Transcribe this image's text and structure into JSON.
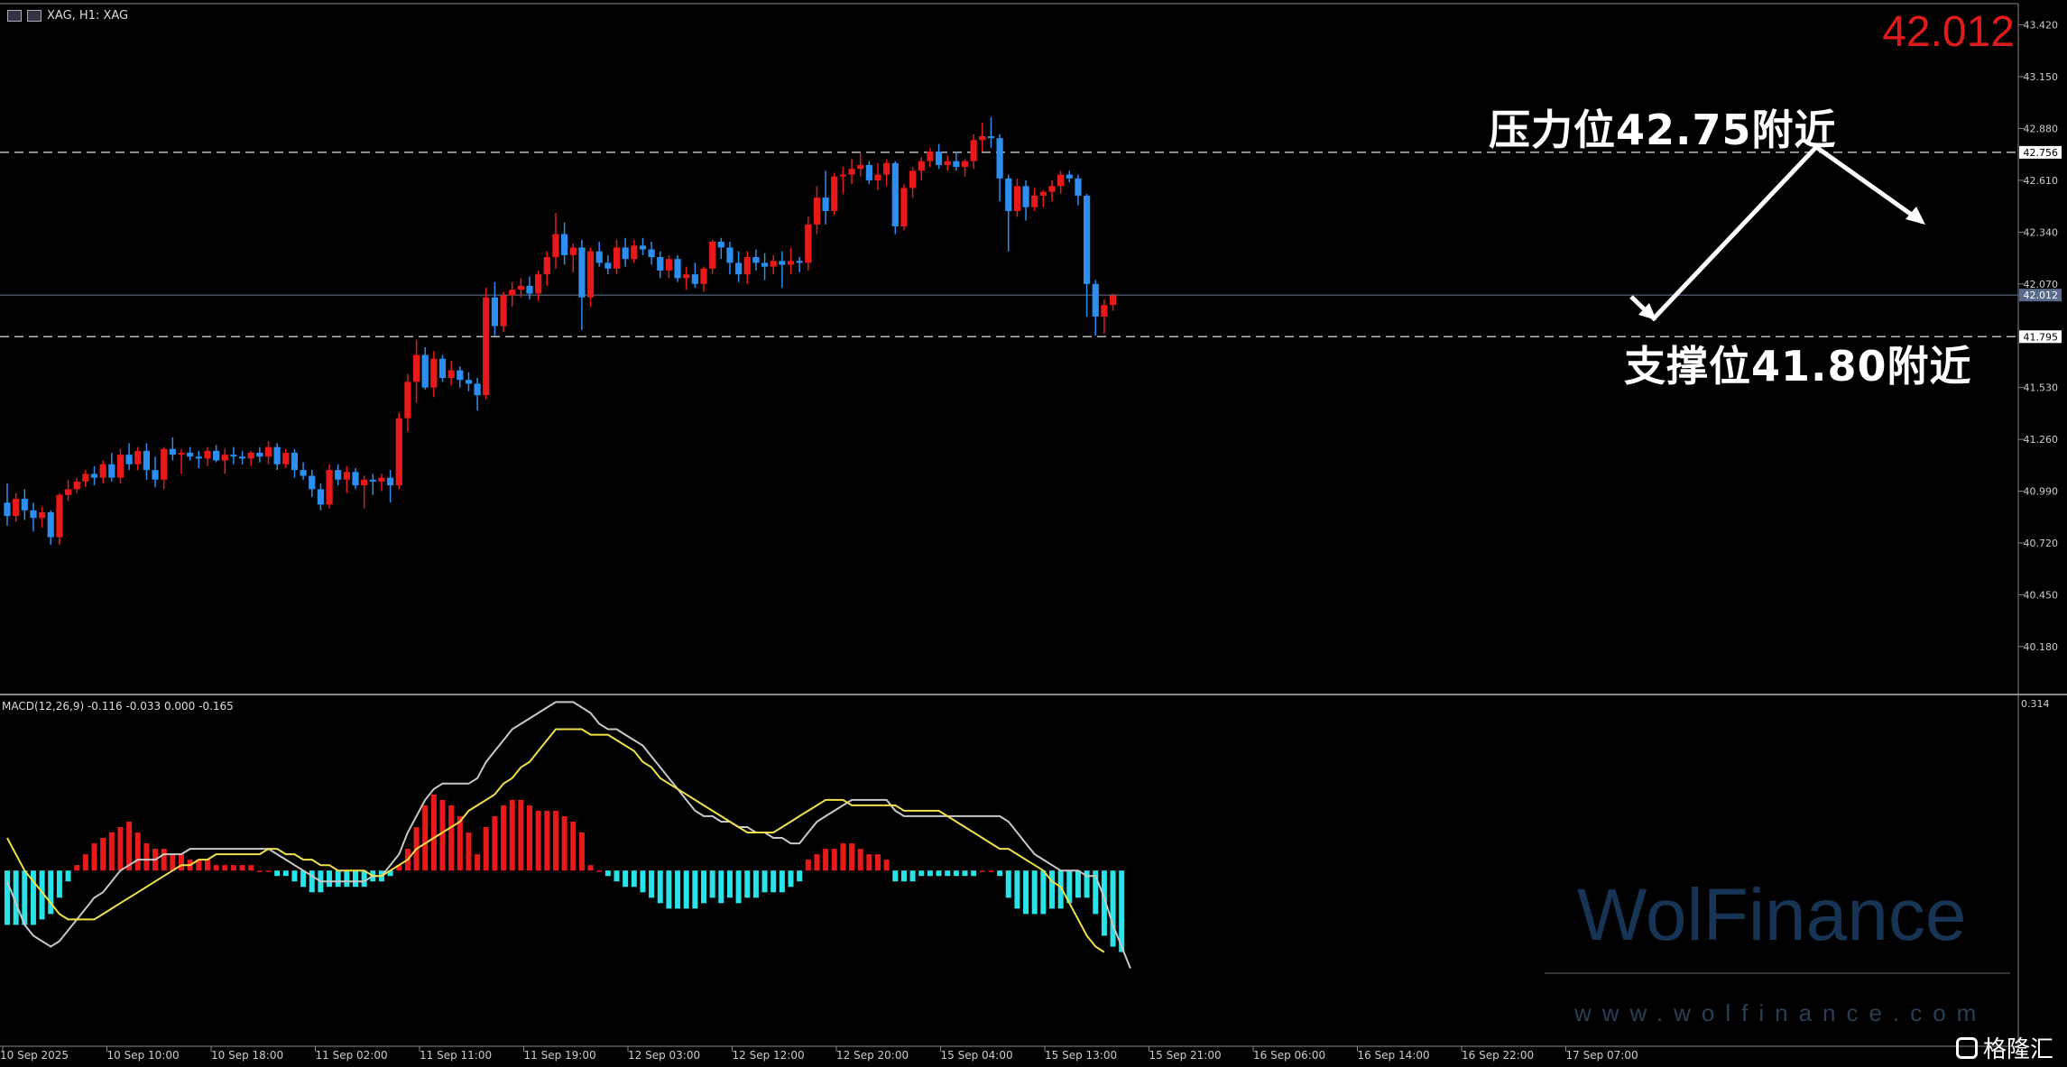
{
  "header": {
    "symbol_label": "XAG, H1:  XAG",
    "current_price": "42.012"
  },
  "annotations": {
    "resistance": "压力位42.75附近",
    "support": "支撑位41.80附近"
  },
  "macd_panel": {
    "label": "MACD(12,26,9) -0.116 -0.033 0.000 -0.165",
    "top_value": "0.314"
  },
  "watermark": {
    "brand": "WolFinance",
    "site": "www.wolfinance.com"
  },
  "logo": {
    "text": "格隆汇"
  },
  "colors": {
    "bull": "#e8191b",
    "bear": "#2b8ef0",
    "hist_pos": "#e8191b",
    "hist_neg": "#29e3e8",
    "macd_line": "#c8c8c8",
    "signal_line": "#f0e04a",
    "current_price_label": "#e01b1b"
  },
  "chart_data": {
    "type": "candlestick",
    "timeframe": "H1",
    "price_ylim": [
      39.93,
      43.55
    ],
    "price_ticks": [
      "43.420",
      "43.150",
      "42.880",
      "42.610",
      "42.340",
      "42.070",
      "41.530",
      "41.260",
      "40.990",
      "40.720",
      "40.450",
      "40.180"
    ],
    "price_levels": {
      "resistance": "42.756",
      "current": "42.012",
      "support": "41.795"
    },
    "x_tick_labels": [
      "10 Sep 2025",
      "10 Sep 10:00",
      "10 Sep 18:00",
      "11 Sep 02:00",
      "11 Sep 11:00",
      "11 Sep 19:00",
      "12 Sep 03:00",
      "12 Sep 12:00",
      "12 Sep 20:00",
      "15 Sep 04:00",
      "15 Sep 13:00",
      "15 Sep 21:00",
      "16 Sep 06:00",
      "16 Sep 14:00",
      "16 Sep 22:00",
      "17 Sep 07:00"
    ],
    "candles": [
      [
        40.93,
        41.03,
        40.81,
        40.86
      ],
      [
        40.86,
        40.98,
        40.83,
        40.95
      ],
      [
        40.95,
        41.0,
        40.84,
        40.89
      ],
      [
        40.89,
        40.93,
        40.78,
        40.85
      ],
      [
        40.85,
        40.91,
        40.8,
        40.88
      ],
      [
        40.88,
        40.89,
        40.71,
        40.75
      ],
      [
        40.75,
        40.98,
        40.71,
        40.97
      ],
      [
        40.97,
        41.05,
        40.94,
        41.0
      ],
      [
        41.0,
        41.06,
        40.98,
        41.04
      ],
      [
        41.04,
        41.1,
        41.01,
        41.08
      ],
      [
        41.08,
        41.12,
        41.02,
        41.06
      ],
      [
        41.06,
        41.15,
        41.03,
        41.13
      ],
      [
        41.13,
        41.19,
        41.04,
        41.06
      ],
      [
        41.06,
        41.21,
        41.03,
        41.18
      ],
      [
        41.18,
        41.24,
        41.1,
        41.13
      ],
      [
        41.13,
        41.22,
        41.1,
        41.2
      ],
      [
        41.2,
        41.24,
        41.05,
        41.1
      ],
      [
        41.1,
        41.17,
        41.01,
        41.05
      ],
      [
        41.05,
        41.22,
        41.0,
        41.21
      ],
      [
        41.21,
        41.27,
        41.15,
        41.18
      ],
      [
        41.18,
        41.21,
        41.08,
        41.19
      ],
      [
        41.19,
        41.22,
        41.15,
        41.17
      ],
      [
        41.17,
        41.2,
        41.11,
        41.16
      ],
      [
        41.16,
        41.22,
        41.12,
        41.2
      ],
      [
        41.2,
        41.23,
        41.14,
        41.15
      ],
      [
        41.15,
        41.21,
        41.08,
        41.18
      ],
      [
        41.18,
        41.22,
        41.13,
        41.17
      ],
      [
        41.17,
        41.2,
        41.13,
        41.16
      ],
      [
        41.16,
        41.2,
        41.12,
        41.19
      ],
      [
        41.19,
        41.22,
        41.14,
        41.17
      ],
      [
        41.17,
        41.25,
        41.13,
        41.22
      ],
      [
        41.22,
        41.24,
        41.1,
        41.13
      ],
      [
        41.13,
        41.21,
        41.11,
        41.19
      ],
      [
        41.19,
        41.21,
        41.06,
        41.1
      ],
      [
        41.1,
        41.14,
        41.05,
        41.07
      ],
      [
        41.07,
        41.1,
        40.96,
        41.0
      ],
      [
        41.0,
        41.03,
        40.89,
        40.92
      ],
      [
        40.92,
        41.13,
        40.9,
        41.1
      ],
      [
        41.1,
        41.13,
        41.02,
        41.05
      ],
      [
        41.05,
        41.12,
        40.98,
        41.09
      ],
      [
        41.09,
        41.11,
        41.0,
        41.02
      ],
      [
        41.02,
        41.07,
        40.9,
        41.05
      ],
      [
        41.05,
        41.08,
        40.97,
        41.04
      ],
      [
        41.04,
        41.08,
        40.99,
        41.06
      ],
      [
        41.06,
        41.1,
        40.93,
        41.02
      ],
      [
        41.02,
        41.4,
        41.0,
        41.37
      ],
      [
        41.37,
        41.6,
        41.3,
        41.56
      ],
      [
        41.56,
        41.78,
        41.45,
        41.7
      ],
      [
        41.7,
        41.74,
        41.52,
        41.53
      ],
      [
        41.53,
        41.72,
        41.48,
        41.68
      ],
      [
        41.68,
        41.7,
        41.56,
        41.58
      ],
      [
        41.58,
        41.67,
        41.54,
        41.62
      ],
      [
        41.62,
        41.64,
        41.53,
        41.57
      ],
      [
        41.57,
        41.61,
        41.51,
        41.55
      ],
      [
        41.55,
        41.58,
        41.41,
        41.49
      ],
      [
        41.49,
        42.05,
        41.47,
        42.0
      ],
      [
        42.0,
        42.08,
        41.8,
        41.85
      ],
      [
        41.85,
        42.03,
        41.82,
        42.01
      ],
      [
        42.01,
        42.08,
        41.95,
        42.04
      ],
      [
        42.04,
        42.1,
        42.0,
        42.06
      ],
      [
        42.06,
        42.11,
        41.99,
        42.02
      ],
      [
        42.02,
        42.14,
        41.98,
        42.12
      ],
      [
        42.12,
        42.24,
        42.06,
        42.21
      ],
      [
        42.21,
        42.44,
        42.15,
        42.33
      ],
      [
        42.33,
        42.39,
        42.17,
        42.22
      ],
      [
        42.22,
        42.28,
        42.13,
        42.26
      ],
      [
        42.26,
        42.3,
        41.83,
        42.0
      ],
      [
        42.0,
        42.26,
        41.95,
        42.24
      ],
      [
        42.24,
        42.29,
        42.16,
        42.18
      ],
      [
        42.18,
        42.22,
        42.12,
        42.15
      ],
      [
        42.15,
        42.3,
        42.12,
        42.26
      ],
      [
        42.26,
        42.31,
        42.16,
        42.2
      ],
      [
        42.2,
        42.3,
        42.18,
        42.27
      ],
      [
        42.27,
        42.31,
        42.22,
        42.25
      ],
      [
        42.25,
        42.29,
        42.17,
        42.21
      ],
      [
        42.21,
        42.24,
        42.1,
        42.14
      ],
      [
        42.14,
        42.22,
        42.1,
        42.2
      ],
      [
        42.2,
        42.22,
        42.08,
        42.1
      ],
      [
        42.1,
        42.16,
        42.04,
        42.12
      ],
      [
        42.12,
        42.18,
        42.05,
        42.07
      ],
      [
        42.07,
        42.16,
        42.03,
        42.15
      ],
      [
        42.15,
        42.3,
        42.12,
        42.29
      ],
      [
        42.29,
        42.31,
        42.2,
        42.26
      ],
      [
        42.26,
        42.29,
        42.12,
        42.18
      ],
      [
        42.18,
        42.24,
        42.08,
        42.12
      ],
      [
        42.12,
        42.24,
        42.07,
        42.21
      ],
      [
        42.21,
        42.25,
        42.14,
        42.18
      ],
      [
        42.18,
        42.23,
        42.09,
        42.16
      ],
      [
        42.16,
        42.22,
        42.12,
        42.19
      ],
      [
        42.19,
        42.24,
        42.05,
        42.17
      ],
      [
        42.17,
        42.26,
        42.12,
        42.19
      ],
      [
        42.19,
        42.21,
        42.13,
        42.18
      ],
      [
        42.18,
        42.42,
        42.14,
        42.38
      ],
      [
        42.38,
        42.58,
        42.33,
        42.52
      ],
      [
        42.52,
        42.66,
        42.38,
        42.45
      ],
      [
        42.45,
        42.65,
        42.43,
        42.63
      ],
      [
        42.63,
        42.68,
        42.54,
        42.64
      ],
      [
        42.64,
        42.72,
        42.59,
        42.67
      ],
      [
        42.67,
        42.75,
        42.63,
        42.69
      ],
      [
        42.69,
        42.71,
        42.59,
        42.61
      ],
      [
        42.61,
        42.7,
        42.56,
        42.64
      ],
      [
        42.64,
        42.72,
        42.58,
        42.7
      ],
      [
        42.7,
        42.71,
        42.33,
        42.37
      ],
      [
        42.37,
        42.59,
        42.35,
        42.57
      ],
      [
        42.57,
        42.68,
        42.52,
        42.66
      ],
      [
        42.66,
        42.73,
        42.61,
        42.71
      ],
      [
        42.71,
        42.78,
        42.68,
        42.76
      ],
      [
        42.76,
        42.8,
        42.67,
        42.69
      ],
      [
        42.69,
        42.74,
        42.66,
        42.71
      ],
      [
        42.71,
        42.76,
        42.66,
        42.68
      ],
      [
        42.68,
        42.72,
        42.63,
        42.71
      ],
      [
        42.71,
        42.85,
        42.67,
        42.82
      ],
      [
        42.82,
        42.91,
        42.76,
        42.84
      ],
      [
        42.84,
        42.94,
        42.78,
        42.83
      ],
      [
        42.83,
        42.85,
        42.5,
        42.62
      ],
      [
        42.62,
        42.64,
        42.24,
        42.45
      ],
      [
        42.45,
        42.62,
        42.42,
        42.58
      ],
      [
        42.58,
        42.61,
        42.4,
        42.47
      ],
      [
        42.47,
        42.57,
        42.45,
        42.53
      ],
      [
        42.53,
        42.56,
        42.47,
        42.55
      ],
      [
        42.55,
        42.61,
        42.5,
        42.58
      ],
      [
        42.58,
        42.66,
        42.54,
        42.64
      ],
      [
        42.64,
        42.66,
        42.6,
        42.62
      ],
      [
        42.62,
        42.64,
        42.48,
        42.53
      ],
      [
        42.53,
        42.54,
        41.9,
        42.07
      ],
      [
        42.07,
        42.09,
        41.8,
        41.9
      ],
      [
        41.9,
        41.99,
        41.81,
        41.96
      ],
      [
        41.96,
        42.02,
        41.93,
        42.01
      ]
    ],
    "macd_panel_range": [
      -0.32,
      0.314
    ],
    "histogram": [
      -0.1,
      -0.1,
      -0.1,
      -0.1,
      -0.09,
      -0.08,
      -0.05,
      -0.02,
      0.01,
      0.03,
      0.05,
      0.06,
      0.07,
      0.08,
      0.09,
      0.07,
      0.05,
      0.04,
      0.04,
      0.03,
      0.03,
      0.02,
      0.02,
      0.02,
      0.01,
      0.01,
      0.01,
      0.01,
      0.01,
      0.0,
      0.0,
      -0.01,
      -0.01,
      -0.02,
      -0.03,
      -0.04,
      -0.04,
      -0.03,
      -0.03,
      -0.03,
      -0.03,
      -0.03,
      -0.02,
      -0.02,
      -0.01,
      0.01,
      0.04,
      0.08,
      0.12,
      0.14,
      0.13,
      0.12,
      0.1,
      0.07,
      0.03,
      0.08,
      0.1,
      0.12,
      0.13,
      0.13,
      0.12,
      0.11,
      0.11,
      0.11,
      0.1,
      0.09,
      0.07,
      0.01,
      0.0,
      -0.01,
      -0.02,
      -0.03,
      -0.03,
      -0.04,
      -0.05,
      -0.06,
      -0.07,
      -0.07,
      -0.07,
      -0.07,
      -0.06,
      -0.05,
      -0.06,
      -0.05,
      -0.06,
      -0.05,
      -0.05,
      -0.04,
      -0.04,
      -0.04,
      -0.03,
      -0.02,
      0.02,
      0.03,
      0.04,
      0.04,
      0.05,
      0.05,
      0.04,
      0.03,
      0.03,
      0.02,
      -0.02,
      -0.02,
      -0.02,
      -0.01,
      -0.01,
      -0.01,
      -0.01,
      -0.01,
      -0.01,
      -0.01,
      0.0,
      0.0,
      -0.01,
      -0.05,
      -0.07,
      -0.08,
      -0.08,
      -0.08,
      -0.07,
      -0.07,
      -0.06,
      -0.05,
      -0.05,
      -0.08,
      -0.12,
      -0.14,
      -0.15
    ],
    "macd_line": [
      -0.02,
      -0.06,
      -0.1,
      -0.12,
      -0.13,
      -0.14,
      -0.13,
      -0.11,
      -0.09,
      -0.07,
      -0.05,
      -0.04,
      -0.02,
      0.0,
      0.01,
      0.02,
      0.02,
      0.02,
      0.03,
      0.03,
      0.03,
      0.04,
      0.04,
      0.04,
      0.04,
      0.04,
      0.04,
      0.04,
      0.04,
      0.04,
      0.04,
      0.03,
      0.02,
      0.01,
      0.0,
      -0.01,
      -0.02,
      -0.02,
      -0.02,
      -0.02,
      -0.02,
      -0.02,
      -0.01,
      -0.01,
      0.01,
      0.03,
      0.07,
      0.1,
      0.13,
      0.15,
      0.16,
      0.16,
      0.16,
      0.16,
      0.17,
      0.2,
      0.22,
      0.24,
      0.26,
      0.27,
      0.28,
      0.29,
      0.3,
      0.31,
      0.31,
      0.31,
      0.3,
      0.29,
      0.27,
      0.26,
      0.26,
      0.25,
      0.24,
      0.23,
      0.21,
      0.19,
      0.17,
      0.15,
      0.13,
      0.11,
      0.1,
      0.1,
      0.09,
      0.09,
      0.08,
      0.08,
      0.07,
      0.07,
      0.06,
      0.06,
      0.05,
      0.05,
      0.07,
      0.09,
      0.1,
      0.11,
      0.12,
      0.13,
      0.13,
      0.13,
      0.13,
      0.13,
      0.11,
      0.1,
      0.1,
      0.1,
      0.1,
      0.1,
      0.1,
      0.1,
      0.1,
      0.1,
      0.1,
      0.1,
      0.1,
      0.09,
      0.07,
      0.05,
      0.03,
      0.02,
      0.01,
      0.0,
      0.0,
      0.0,
      -0.01,
      -0.01,
      -0.05,
      -0.1,
      -0.14,
      -0.18
    ],
    "signal_line": [
      0.06,
      0.03,
      0.0,
      -0.02,
      -0.04,
      -0.06,
      -0.08,
      -0.09,
      -0.09,
      -0.09,
      -0.09,
      -0.08,
      -0.07,
      -0.06,
      -0.05,
      -0.04,
      -0.03,
      -0.02,
      -0.01,
      0.0,
      0.01,
      0.01,
      0.02,
      0.02,
      0.03,
      0.03,
      0.03,
      0.03,
      0.03,
      0.03,
      0.04,
      0.04,
      0.03,
      0.03,
      0.02,
      0.02,
      0.01,
      0.01,
      0.0,
      0.0,
      0.0,
      0.0,
      -0.01,
      -0.01,
      0.0,
      0.01,
      0.02,
      0.04,
      0.05,
      0.06,
      0.07,
      0.08,
      0.09,
      0.11,
      0.12,
      0.13,
      0.14,
      0.16,
      0.17,
      0.19,
      0.2,
      0.22,
      0.24,
      0.26,
      0.26,
      0.26,
      0.26,
      0.25,
      0.25,
      0.25,
      0.24,
      0.23,
      0.22,
      0.2,
      0.19,
      0.17,
      0.16,
      0.15,
      0.14,
      0.13,
      0.12,
      0.11,
      0.1,
      0.09,
      0.08,
      0.07,
      0.07,
      0.07,
      0.07,
      0.08,
      0.09,
      0.1,
      0.11,
      0.12,
      0.13,
      0.13,
      0.13,
      0.12,
      0.12,
      0.12,
      0.12,
      0.12,
      0.12,
      0.11,
      0.11,
      0.11,
      0.11,
      0.11,
      0.1,
      0.09,
      0.08,
      0.07,
      0.06,
      0.05,
      0.04,
      0.04,
      0.03,
      0.02,
      0.01,
      0.0,
      -0.02,
      -0.03,
      -0.06,
      -0.09,
      -0.12,
      -0.14,
      -0.15
    ]
  }
}
